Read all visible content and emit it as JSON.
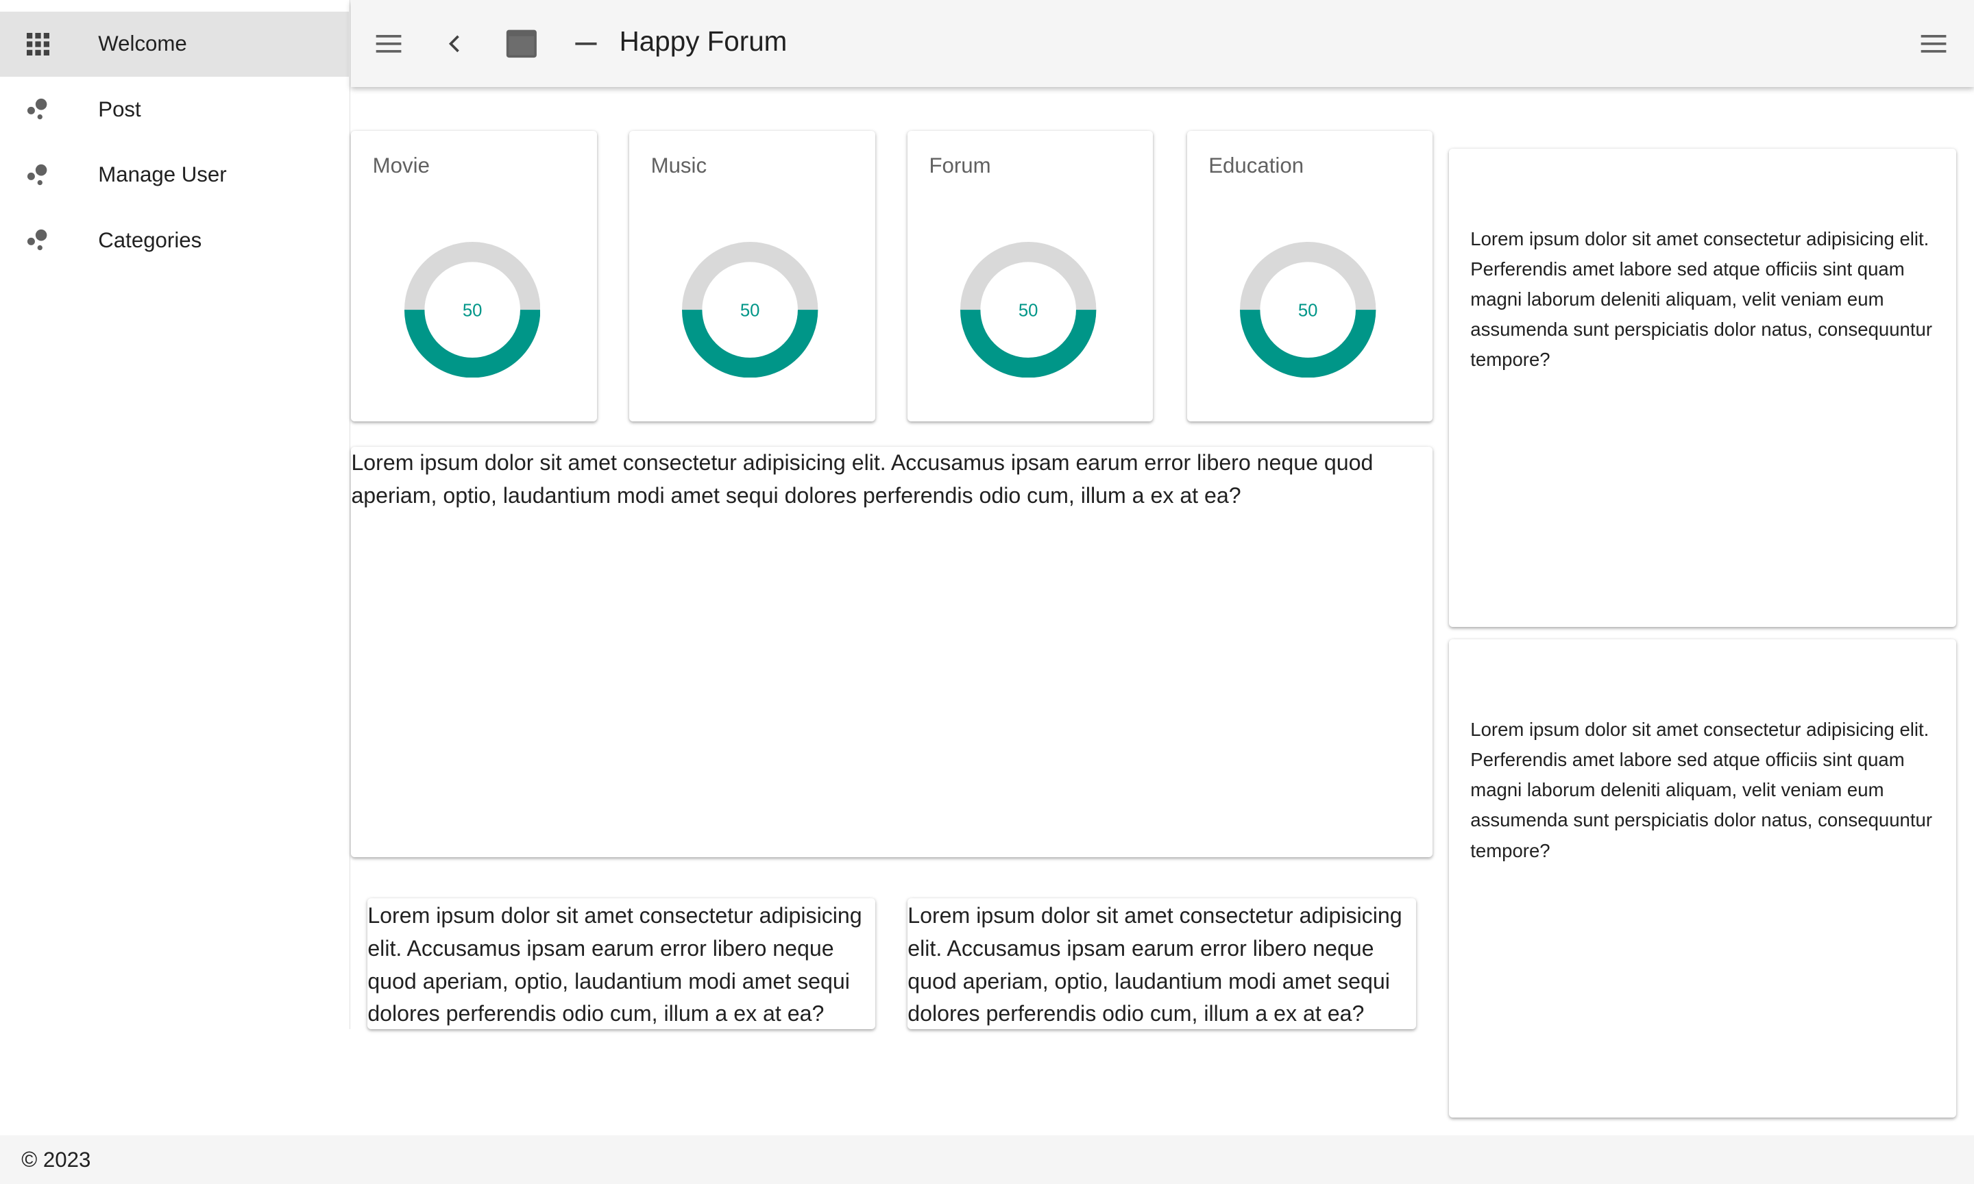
{
  "sidebar": {
    "items": [
      {
        "label": "Welcome",
        "icon": "apps-grid-icon",
        "active": true
      },
      {
        "label": "Post",
        "icon": "bubbles-icon",
        "active": false
      },
      {
        "label": "Manage User",
        "icon": "bubbles-icon",
        "active": false
      },
      {
        "label": "Categories",
        "icon": "bubbles-icon",
        "active": false
      }
    ]
  },
  "header": {
    "title": "Happy Forum",
    "icons": [
      "menu-icon",
      "chevron-left-icon",
      "window-icon",
      "minimize-icon",
      "menu-icon"
    ]
  },
  "stats": [
    {
      "title": "Movie",
      "value": "50",
      "percent": 50
    },
    {
      "title": "Music",
      "value": "50",
      "percent": 50
    },
    {
      "title": "Forum",
      "value": "50",
      "percent": 50
    },
    {
      "title": "Education",
      "value": "50",
      "percent": 50
    }
  ],
  "colors": {
    "accent": "#009688",
    "track": "#d9d9d9",
    "bar": "#f5f5f5",
    "active": "#e3e3e3"
  },
  "main_text": "Lorem ipsum dolor sit amet consectetur adipisicing elit. Accusamus ipsam earum error libero neque quod aperiam, optio, laudantium modi amet sequi dolores perferendis odio cum, illum a ex at ea?",
  "bottom_cards": [
    "Lorem ipsum dolor sit amet consectetur adipisicing elit. Accusamus ipsam earum error libero neque quod aperiam, optio, laudantium modi amet sequi dolores perferendis odio cum, illum a ex at ea?",
    "Lorem ipsum dolor sit amet consectetur adipisicing elit. Accusamus ipsam earum error libero neque quod aperiam, optio, laudantium modi amet sequi dolores perferendis odio cum, illum a ex at ea?"
  ],
  "side_cards": [
    "Lorem ipsum dolor sit amet consectetur adipisicing elit. Perferendis amet labore sed atque officiis sint quam magni laborum deleniti aliquam, velit veniam eum assumenda sunt perspiciatis dolor natus, consequuntur tempore?",
    "Lorem ipsum dolor sit amet consectetur adipisicing elit. Perferendis amet labore sed atque officiis sint quam magni laborum deleniti aliquam, velit veniam eum assumenda sunt perspiciatis dolor natus, consequuntur tempore?"
  ],
  "footer": {
    "text": "© 2023"
  }
}
